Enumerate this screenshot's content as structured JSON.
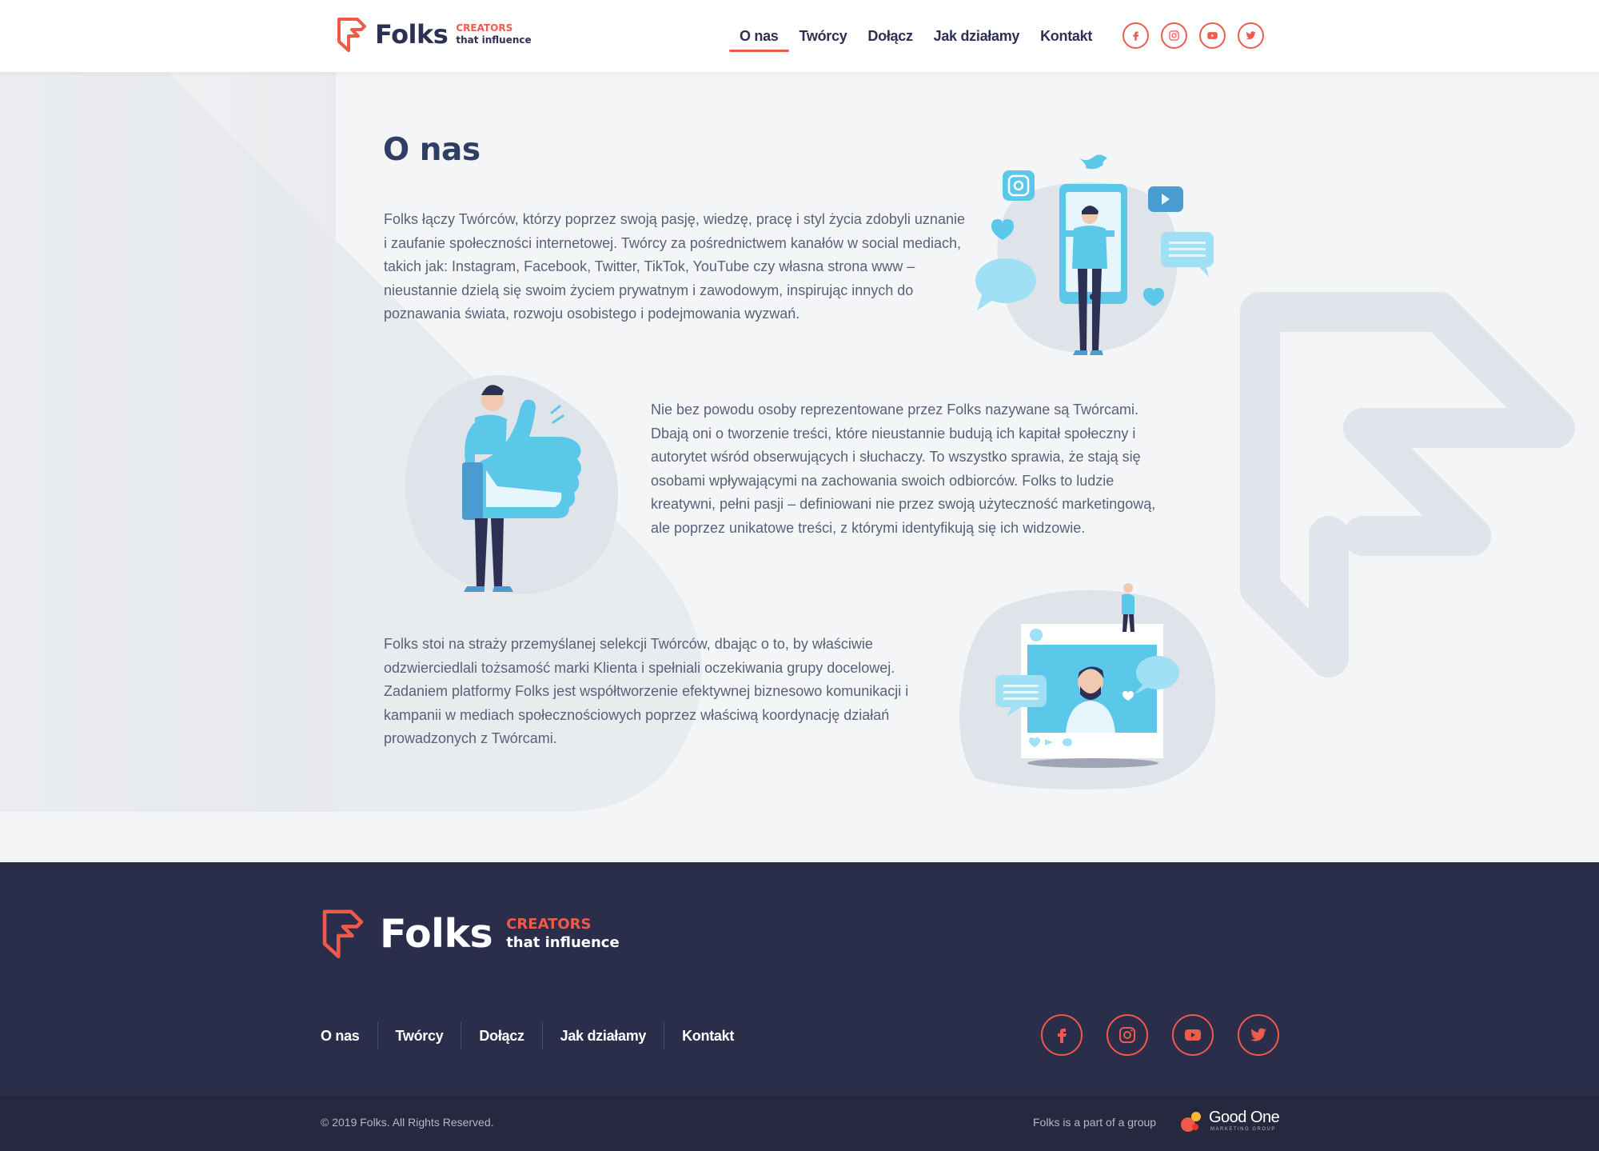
{
  "brand": {
    "name": "Folks",
    "tag_line1": "CREATORS",
    "tag_line2": "that influence"
  },
  "colors": {
    "accent": "#f05a4a",
    "navy": "#2c3153",
    "footer_bg": "#2b2e4a",
    "bottom_bar_bg": "#262840",
    "illustration_blue": "#5bc8ea"
  },
  "nav": {
    "items": [
      {
        "label": "O nas",
        "active": true
      },
      {
        "label": "Twórcy",
        "active": false
      },
      {
        "label": "Dołącz",
        "active": false
      },
      {
        "label": "Jak działamy",
        "active": false
      },
      {
        "label": "Kontakt",
        "active": false
      }
    ]
  },
  "socials": [
    "facebook-icon",
    "instagram-icon",
    "youtube-icon",
    "twitter-icon"
  ],
  "main": {
    "title": "O nas",
    "paragraphs": [
      "Folks łączy Twórców, którzy poprzez swoją pasję, wiedzę, pracę i styl życia zdobyli uznanie i zaufanie społeczności internetowej. Twórcy za pośrednictwem kanałów w social mediach, takich jak: Instagram, Facebook, Twitter, TikTok, YouTube czy własna strona www – nieustannie dzielą się swoim życiem prywatnym i zawodowym, inspirując innych do poznawania świata, rozwoju osobistego i podejmowania wyzwań.",
      "Nie bez powodu osoby reprezentowane przez Folks nazywane są Twórcami. Dbają oni o tworzenie treści, które nieustannie budują ich kapitał społeczny i autorytet wśród obserwujących i słuchaczy. To wszystko sprawia, że stają się osobami wpływającymi na zachowania swoich odbiorców. Folks to ludzie kreatywni, pełni pasji – definiowani nie przez swoją użyteczność marketingową, ale poprzez unikatowe treści, z którymi identyfikują się ich widzowie.",
      "Folks stoi na straży przemyślanej selekcji Twórców, dbając o to, by właściwie odzwierciedlali tożsamość marki Klienta i spełniali oczekiwania grupy docelowej. Zadaniem platformy Folks jest współtworzenie efektywnej biznesowo komunikacji i kampanii w mediach społecznościowych poprzez właściwą koordynację działań prowadzonych z Twórcami."
    ]
  },
  "footer": {
    "nav": [
      "O nas",
      "Twórcy",
      "Dołącz",
      "Jak działamy",
      "Kontakt"
    ],
    "copyright": "© 2019 Folks. All Rights Reserved.",
    "group_text": "Folks is a part of a group",
    "group_name": "Good One",
    "group_sub": "MARKETING GROUP"
  }
}
